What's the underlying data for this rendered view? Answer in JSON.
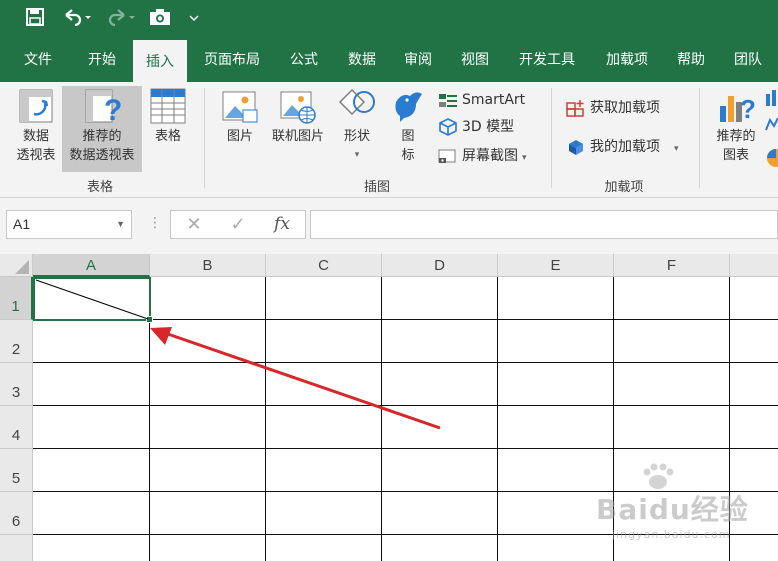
{
  "quick_access": {
    "save": "save-icon",
    "undo": "undo-icon",
    "redo": "redo-icon",
    "camera": "camera-icon",
    "customize": "customize-icon"
  },
  "tabs": [
    {
      "label": "文件"
    },
    {
      "label": "开始"
    },
    {
      "label": "插入",
      "active": true
    },
    {
      "label": "页面布局"
    },
    {
      "label": "公式"
    },
    {
      "label": "数据"
    },
    {
      "label": "审阅"
    },
    {
      "label": "视图"
    },
    {
      "label": "开发工具"
    },
    {
      "label": "加载项"
    },
    {
      "label": "帮助"
    },
    {
      "label": "团队"
    }
  ],
  "ribbon": {
    "tables_group": {
      "label": "表格",
      "pivot_line1": "数据",
      "pivot_line2": "透视表",
      "recommended_line1": "推荐的",
      "recommended_line2": "数据透视表",
      "table": "表格"
    },
    "illustrations_group": {
      "label": "插图",
      "pictures": "图片",
      "online_pictures": "联机图片",
      "shapes": "形状",
      "icons_line1": "图",
      "icons_line2": "标",
      "smartart": "SmartArt",
      "models3d": "3D 模型",
      "screenshot": "屏幕截图"
    },
    "addins_group": {
      "label": "加载项",
      "get_addins": "获取加载项",
      "my_addins": "我的加载项"
    },
    "charts_group": {
      "recommended_line1": "推荐的",
      "recommended_line2": "图表"
    }
  },
  "formula_bar": {
    "name_box": "A1",
    "cancel": "✕",
    "enter": "✓",
    "fx": "fx",
    "value": ""
  },
  "sheet": {
    "columns": [
      "A",
      "B",
      "C",
      "D",
      "E",
      "F"
    ],
    "rows": [
      "1",
      "2",
      "3",
      "4",
      "5",
      "6"
    ],
    "selected_cell": "A1"
  },
  "watermark": {
    "brand": "Baidu经验",
    "sub": "jingyan.baidu.com"
  },
  "colors": {
    "excel_green": "#217346",
    "ribbon_bg": "#f3f3f3",
    "arrow_red": "#d9262a"
  }
}
